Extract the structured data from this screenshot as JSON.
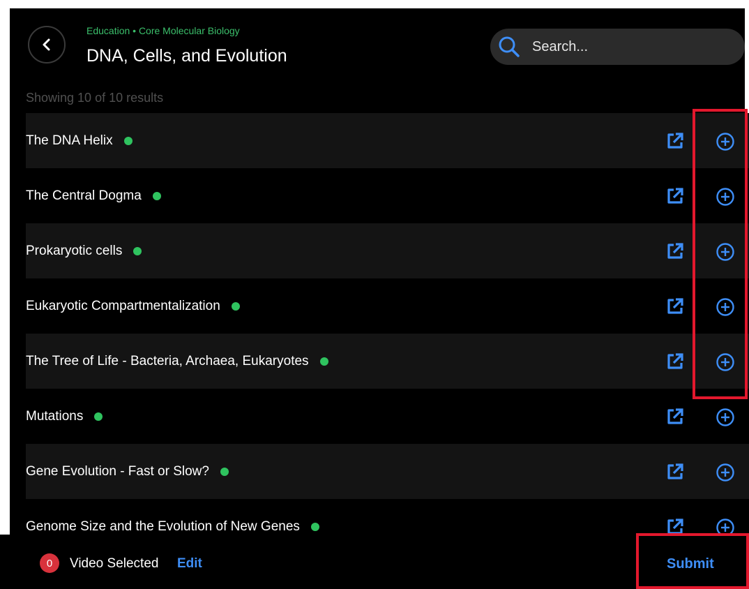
{
  "header": {
    "breadcrumb": "Education • Core Molecular Biology",
    "title": "DNA, Cells, and Evolution",
    "search_placeholder": "Search..."
  },
  "result_count": "Showing 10 of 10 results",
  "items": [
    {
      "title": "The DNA Helix"
    },
    {
      "title": "The Central Dogma"
    },
    {
      "title": "Prokaryotic cells"
    },
    {
      "title": "Eukaryotic Compartmentalization"
    },
    {
      "title": "The Tree of Life - Bacteria, Archaea, Eukaryotes"
    },
    {
      "title": "Mutations"
    },
    {
      "title": "Gene Evolution - Fast or Slow?"
    },
    {
      "title": "Genome Size and the Evolution of New Genes"
    }
  ],
  "footer": {
    "selected_count": "0",
    "selected_label": "Video Selected",
    "edit_label": "Edit",
    "submit_label": "Submit"
  },
  "colors": {
    "accent_blue": "#3e8ef7",
    "status_green": "#2fc35f",
    "highlight_red": "#e3182d",
    "badge_red": "#d8323c"
  },
  "icons": [
    "back-arrow-icon",
    "search-icon",
    "external-link-icon",
    "add-circle-icon",
    "status-dot-icon"
  ]
}
